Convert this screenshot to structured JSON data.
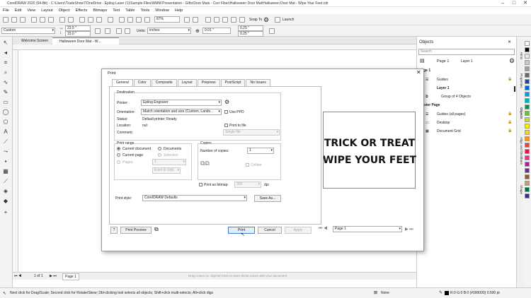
{
  "app": {
    "title": "CorelDRAW 2020 (64-Bit) - C:\\Users\\TradeShow7\\OneDrive - Epilog Laser (1)\\Sample Files\\WMM Presentation - Gifts\\Door Mats - Corr Fiber\\Halloween Door Mat\\Halloween Door Mat - Wipe Your Feet.cdr"
  },
  "menu": [
    "File",
    "Edit",
    "View",
    "Layout",
    "Object",
    "Effects",
    "Bitmaps",
    "Text",
    "Table",
    "Tools",
    "Window",
    "Help"
  ],
  "toolbar": {
    "zoom": "87%",
    "snap_to": "Snap To",
    "launch": "Launch"
  },
  "property_bar": {
    "preset": "Custom",
    "width": "23.5 \"",
    "height": "15.0 \"",
    "units_label": "Units:",
    "units": "inches",
    "nudge": "0.01 \"",
    "dup_x": "0.25 \"",
    "dup_y": "0.25 \""
  },
  "doc_tabs": [
    "Welcome Screen",
    "Halloween Door Mat - W..."
  ],
  "page_bar": {
    "page_counter": "1 of 1",
    "page_tab": "Page 1",
    "color_hint": "Drag colors (or objects) here to store these colors with your document"
  },
  "status": {
    "hint": "Next click for Drag/Scale; Second click for Rotate/Skew; Dbl-clicking tool selects all objects; Shift+click multi-selects; Alt+click digs",
    "fill": "None",
    "outline": "R:0 G:0 B:0 (#000000)  0.500 pt"
  },
  "objects": {
    "title": "Objects",
    "search_placeholder": "Search",
    "page_dropdown": "Page 1",
    "layer_dropdown": "Layer 1",
    "rows": [
      {
        "label": "Page 1",
        "bold": true
      },
      {
        "label": "Guides",
        "bold": false
      },
      {
        "label": "Layer 1",
        "bold": true
      },
      {
        "label": "Group of 4 Objects",
        "bold": false
      },
      {
        "label": "Master Page",
        "bold": true
      },
      {
        "label": "Guides (all pages)",
        "bold": false
      },
      {
        "label": "Desktop",
        "bold": false
      },
      {
        "label": "Document Grid",
        "bold": false
      }
    ]
  },
  "side_tabs": [
    "Hints",
    "Properties",
    "Objects",
    "Align and Distribute",
    "Shape"
  ],
  "palette": [
    "#ffffff",
    "#000000",
    "#e8e8e8",
    "#c8c8c8",
    "#a0a0a0",
    "#6a6a6a",
    "#1b4aa0",
    "#0069c9",
    "#00a1e0",
    "#00b4b0",
    "#009a44",
    "#6cbd45",
    "#c7da2a",
    "#fff200",
    "#ffd200",
    "#f7941d",
    "#ef4136",
    "#d7194f",
    "#ed2c8e",
    "#a3248f",
    "#6a2d91",
    "#8b5e3c",
    "#c69c6d",
    "#00703c",
    "#2e3192"
  ],
  "dialog": {
    "title": "Print",
    "tabs": [
      "General",
      "Color",
      "Composite",
      "Layout",
      "Prepress",
      "PostScript",
      "No Issues"
    ],
    "destination_label": "Destination",
    "printer_label": "Printer:",
    "printer": "Epilog Engraver",
    "orientation_label": "Orientation:",
    "orientation": "Match orientation and size (Custom, Lands...",
    "use_ppd": "Use PPD",
    "status_label": "Status:",
    "status": "Default printer; Ready",
    "location_label": "Location:",
    "location": "nul:",
    "comment_label": "Comment:",
    "print_to_file": "Print to file",
    "single_file": "Single file",
    "print_range_label": "Print range",
    "current_document": "Current document",
    "documents": "Documents",
    "current_page": "Current page",
    "selection": "Selection",
    "pages": "Pages:",
    "pages_value": "1",
    "even_odd": "Even & Odd",
    "copies_label": "Copies",
    "number_of_copies": "Number of copies:",
    "copies": "1",
    "collate": "Collate",
    "print_as_bitmap": "Print as bitmap:",
    "dpi_value": "300",
    "dpi": "dpi",
    "print_style_label": "Print style:",
    "print_style": "CorelDRAW Defaults",
    "save_as": "Save As...",
    "help": "?",
    "print_preview": "Print Preview",
    "print": "Print",
    "cancel": "Cancel",
    "apply": "Apply",
    "preview_page": "Page 1",
    "art_line1": "TRICK OR TREAT",
    "art_line2": "WIPE YOUR FEET"
  }
}
